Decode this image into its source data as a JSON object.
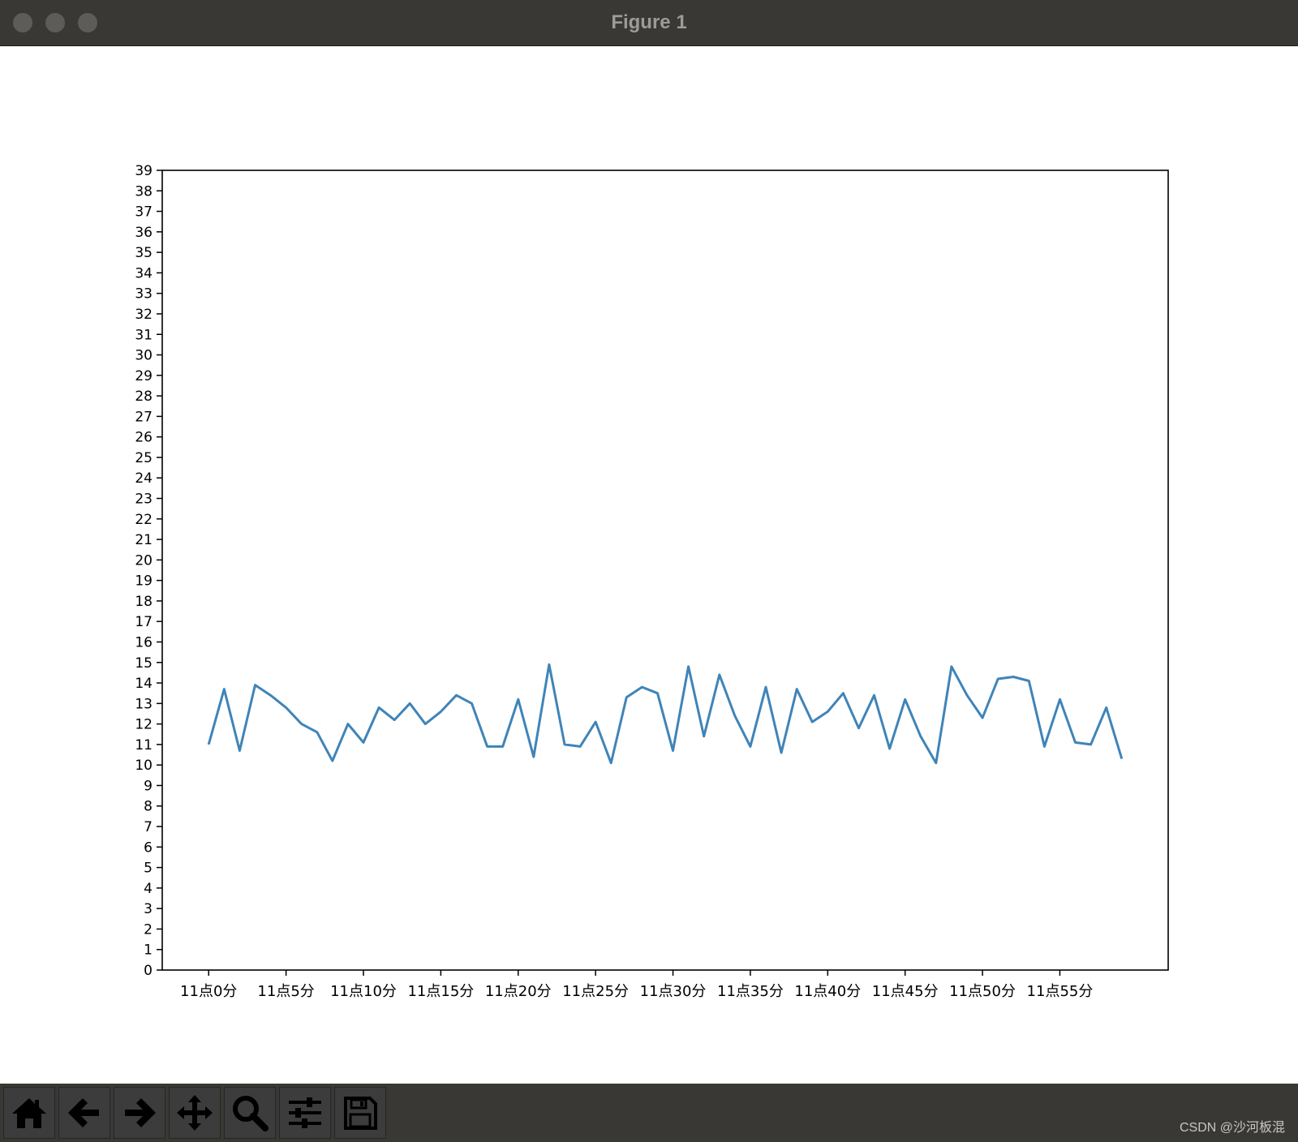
{
  "window": {
    "title": "Figure 1"
  },
  "toolbar": {
    "items": [
      {
        "name": "home",
        "icon": "home-icon"
      },
      {
        "name": "back",
        "icon": "arrow-left-icon"
      },
      {
        "name": "forward",
        "icon": "arrow-right-icon"
      },
      {
        "name": "pan",
        "icon": "move-icon"
      },
      {
        "name": "zoom",
        "icon": "magnifier-icon"
      },
      {
        "name": "configure",
        "icon": "sliders-icon"
      },
      {
        "name": "save",
        "icon": "floppy-disk-icon"
      }
    ]
  },
  "watermark": "CSDN @沙河板混",
  "colors": {
    "line": "#3f84b8",
    "window": "#3a3835",
    "canvas": "#ffffff"
  },
  "chart_data": {
    "type": "line",
    "title": "",
    "xlabel": "",
    "ylabel": "",
    "xlim": [
      -3,
      62
    ],
    "ylim": [
      0,
      39
    ],
    "yticks": [
      0,
      1,
      2,
      3,
      4,
      5,
      6,
      7,
      8,
      9,
      10,
      11,
      12,
      13,
      14,
      15,
      16,
      17,
      18,
      19,
      20,
      21,
      22,
      23,
      24,
      25,
      26,
      27,
      28,
      29,
      30,
      31,
      32,
      33,
      34,
      35,
      36,
      37,
      38,
      39
    ],
    "xticks": [
      0,
      5,
      10,
      15,
      20,
      25,
      30,
      35,
      40,
      45,
      50,
      55
    ],
    "xticklabels": [
      "11点0分",
      "11点5分",
      "11点10分",
      "11点15分",
      "11点20分",
      "11点25分",
      "11点30分",
      "11点35分",
      "11点40分",
      "11点45分",
      "11点50分",
      "11点55分"
    ],
    "grid": false,
    "series": [
      {
        "x": [
          0,
          1,
          2,
          3,
          4,
          5,
          6,
          7,
          8,
          9,
          10,
          11,
          12,
          13,
          14,
          15,
          16,
          17,
          18,
          19,
          20,
          21,
          22,
          23,
          24,
          25,
          26,
          27,
          28,
          29,
          30,
          31,
          32,
          33,
          34,
          35,
          36,
          37,
          38,
          39,
          40,
          41,
          42,
          43,
          44,
          45,
          46,
          47,
          48,
          49,
          50,
          51,
          52,
          53,
          54,
          55,
          56,
          57,
          58,
          59
        ],
        "values": [
          11.0,
          13.7,
          10.7,
          13.9,
          13.4,
          12.8,
          12.0,
          11.6,
          10.2,
          12.0,
          11.1,
          12.8,
          12.2,
          13.0,
          12.0,
          12.6,
          13.4,
          13.0,
          10.9,
          10.9,
          13.2,
          10.4,
          14.9,
          11.0,
          10.9,
          12.1,
          10.1,
          13.3,
          13.8,
          13.5,
          10.7,
          14.8,
          11.4,
          14.4,
          12.4,
          10.9,
          13.8,
          10.6,
          13.7,
          12.1,
          12.6,
          13.5,
          11.8,
          13.4,
          10.8,
          13.2,
          11.4,
          10.1,
          14.8,
          13.4,
          12.3,
          14.2,
          14.3,
          14.1,
          10.9,
          13.2,
          11.1,
          11.0,
          12.8,
          10.3
        ]
      }
    ]
  }
}
